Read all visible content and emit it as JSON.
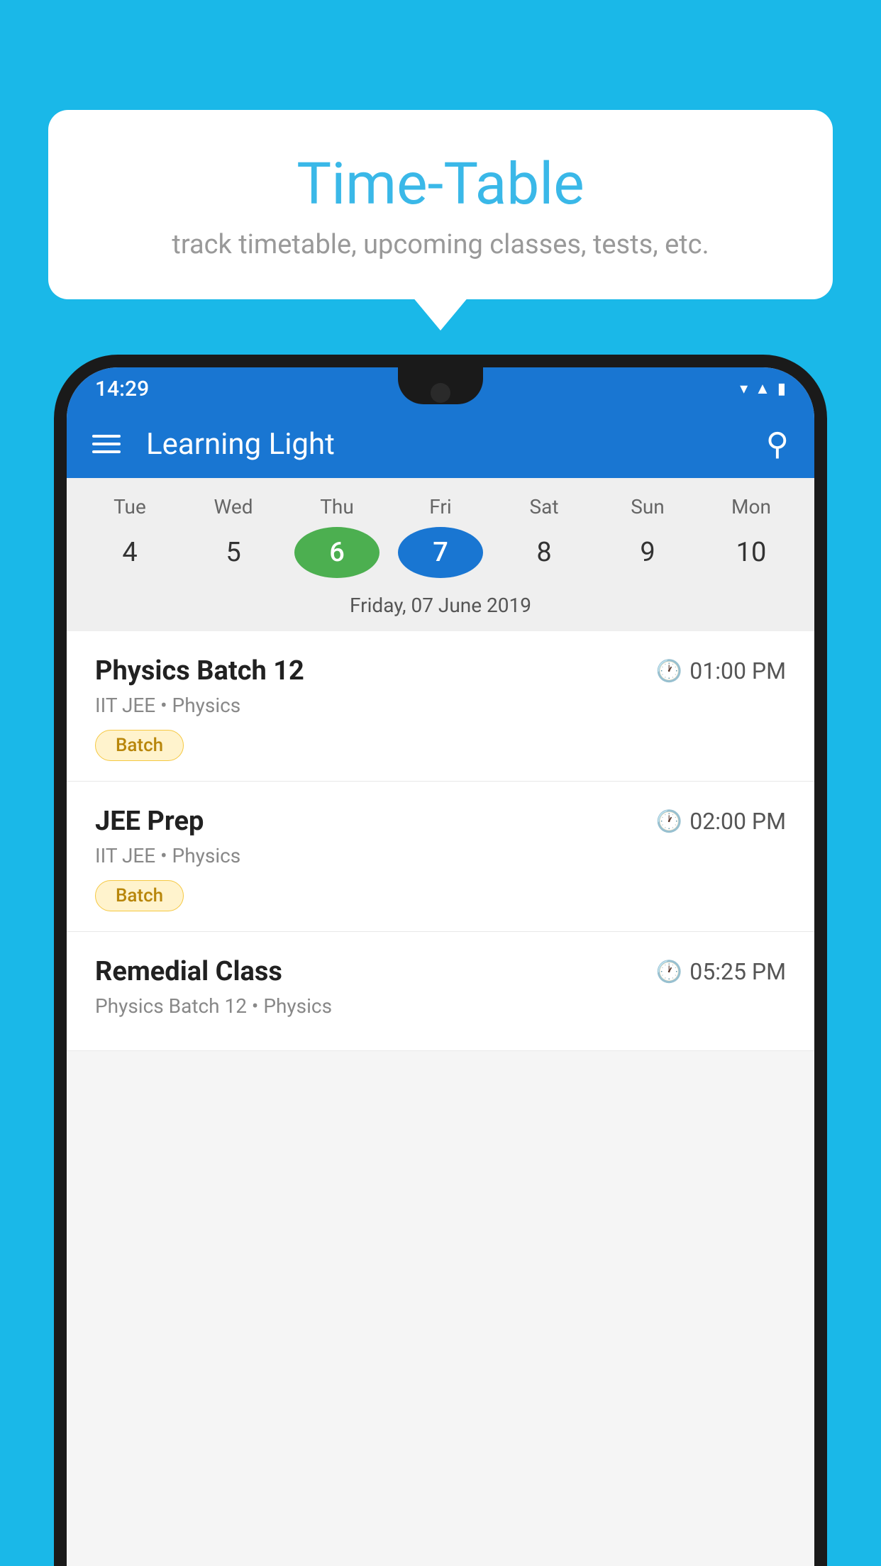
{
  "background_color": "#1ab8e8",
  "bubble": {
    "title": "Time-Table",
    "subtitle": "track timetable, upcoming classes, tests, etc."
  },
  "status_bar": {
    "time": "14:29"
  },
  "app_bar": {
    "title": "Learning Light"
  },
  "calendar": {
    "days": [
      {
        "label": "Tue",
        "number": "4"
      },
      {
        "label": "Wed",
        "number": "5"
      },
      {
        "label": "Thu",
        "number": "6",
        "state": "today"
      },
      {
        "label": "Fri",
        "number": "7",
        "state": "selected"
      },
      {
        "label": "Sat",
        "number": "8"
      },
      {
        "label": "Sun",
        "number": "9"
      },
      {
        "label": "Mon",
        "number": "10"
      }
    ],
    "selected_date": "Friday, 07 June 2019"
  },
  "schedule": [
    {
      "title": "Physics Batch 12",
      "time": "01:00 PM",
      "subtitle": "IIT JEE • Physics",
      "badge": "Batch"
    },
    {
      "title": "JEE Prep",
      "time": "02:00 PM",
      "subtitle": "IIT JEE • Physics",
      "badge": "Batch"
    },
    {
      "title": "Remedial Class",
      "time": "05:25 PM",
      "subtitle": "Physics Batch 12 • Physics",
      "badge": ""
    }
  ]
}
